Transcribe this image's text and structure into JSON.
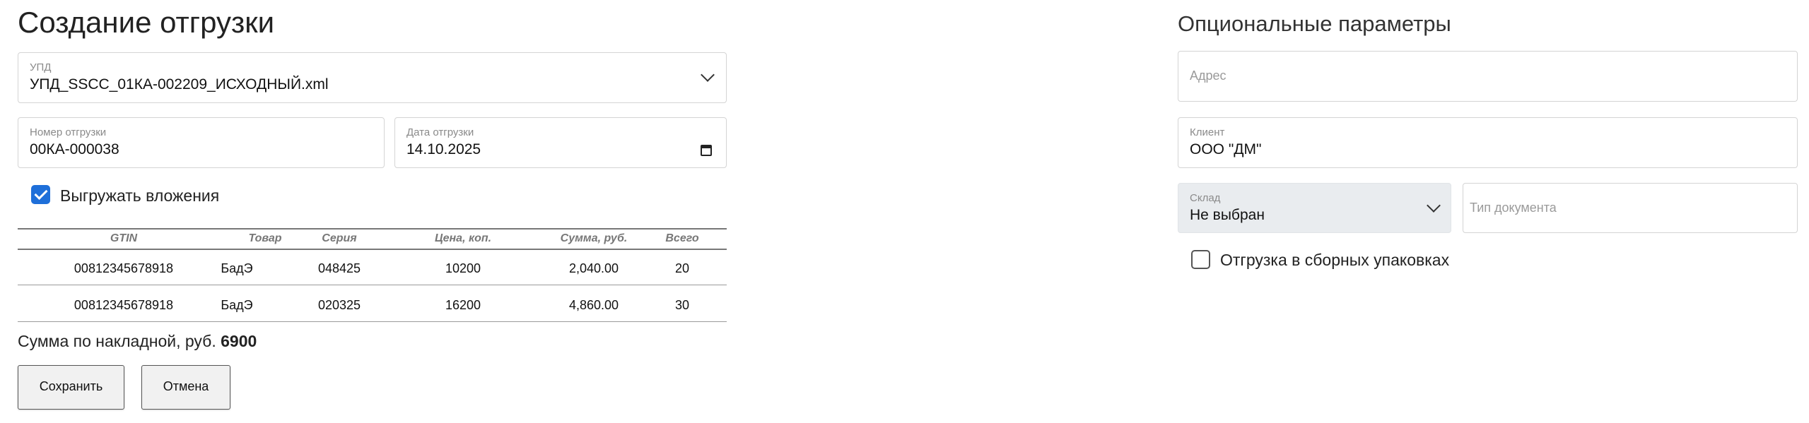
{
  "header": {
    "title": "Создание отгрузки",
    "optional_title": "Опциональные параметры"
  },
  "form": {
    "upd": {
      "label": "УПД",
      "value": "УПД_SSCC_01КА-002209_ИСХОДНЫЙ.xml"
    },
    "shipment_number": {
      "label": "Номер отгрузки",
      "value": "00КА-000038"
    },
    "shipment_date": {
      "label": "Дата отгрузки",
      "value": "14.10.2025"
    },
    "export_attachments": {
      "label": "Выгружать вложения",
      "checked": true
    }
  },
  "table": {
    "columns": [
      "GTIN",
      "Товар",
      "Серия",
      "Цена, коп.",
      "Сумма, руб.",
      "Всего"
    ],
    "rows": [
      [
        "00812345678918",
        "БадЭ",
        "048425",
        "10200",
        "2,040.00",
        "20"
      ],
      [
        "00812345678918",
        "БадЭ",
        "020325",
        "16200",
        "4,860.00",
        "30"
      ]
    ]
  },
  "summary": {
    "label": "Сумма по накладной, руб.",
    "value": "6900"
  },
  "actions": {
    "save_label": "Сохранить",
    "cancel_label": "Отмена"
  },
  "optional": {
    "address": {
      "placeholder": "Адрес"
    },
    "client": {
      "label": "Клиент",
      "value": "ООО \"ДМ\""
    },
    "warehouse": {
      "label": "Склад",
      "value": "Не выбран"
    },
    "doc_type": {
      "placeholder": "Тип документа"
    },
    "bulk_packaging": {
      "label": "Отгрузка в сборных упаковках",
      "checked": false
    }
  },
  "colors": {
    "accent": "#1e6fd9",
    "select_fill": "#e9ecef"
  }
}
